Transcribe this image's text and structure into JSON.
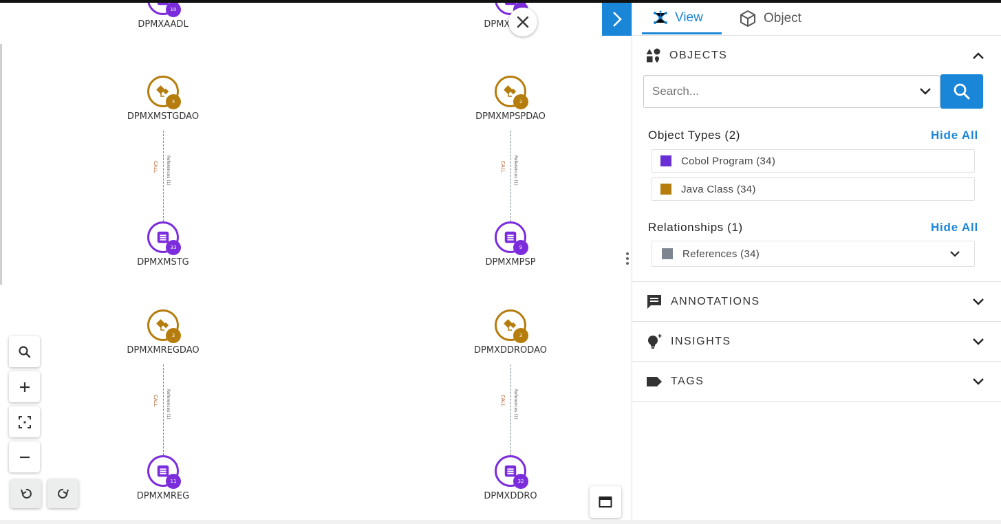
{
  "graph": {
    "nodes": [
      {
        "id": "DPMXAADL",
        "label": "DPMXAADL",
        "type": "cobol",
        "badge": "10"
      },
      {
        "id": "DPMXDCDO",
        "label": "DPMXDCDO",
        "type": "cobol",
        "badge": ""
      },
      {
        "id": "DPMXMSTGDAO",
        "label": "DPMXMSTGDAO",
        "type": "java",
        "badge": "3"
      },
      {
        "id": "DPMXMPSPDAO",
        "label": "DPMXMPSPDAO",
        "type": "java",
        "badge": "2"
      },
      {
        "id": "DPMXMSTG",
        "label": "DPMXMSTG",
        "type": "cobol",
        "badge": "33"
      },
      {
        "id": "DPMXMPSP",
        "label": "DPMXMPSP",
        "type": "cobol",
        "badge": "9"
      },
      {
        "id": "DPMXMREGDAO",
        "label": "DPMXMREGDAO",
        "type": "java",
        "badge": "3"
      },
      {
        "id": "DPMXDDRODAO",
        "label": "DPMXDDRODAO",
        "type": "java",
        "badge": "3"
      },
      {
        "id": "DPMXMREG",
        "label": "DPMXMREG",
        "type": "cobol",
        "badge": "11"
      },
      {
        "id": "DPMXDDRO",
        "label": "DPMXDDRO",
        "type": "cobol",
        "badge": "32"
      }
    ],
    "edges": [
      {
        "from": "DPMXMSTGDAO",
        "to": "DPMXMSTG",
        "call_label": "CALL",
        "ref_label": "References (1)"
      },
      {
        "from": "DPMXMPSPDAO",
        "to": "DPMXMPSP",
        "call_label": "CALL",
        "ref_label": "References (1)"
      },
      {
        "from": "DPMXMREGDAO",
        "to": "DPMXMREG",
        "call_label": "CALL",
        "ref_label": "References (1)"
      },
      {
        "from": "DPMXDDRODAO",
        "to": "DPMXDDRO",
        "call_label": "CALL",
        "ref_label": "References (1)"
      }
    ]
  },
  "canvas_tools": {
    "search": "search-icon",
    "zoom_in": "plus-icon",
    "fit": "fit-screen-icon",
    "zoom_out": "minus-icon",
    "undo": "undo-icon",
    "redo": "redo-icon",
    "fullscreen": "window-icon"
  },
  "panel": {
    "tabs": [
      {
        "label": "View",
        "icon": "graph-network-icon",
        "active": true
      },
      {
        "label": "Object",
        "icon": "cube-icon",
        "active": false
      }
    ],
    "objects": {
      "title": "OBJECTS",
      "search_placeholder": "Search...",
      "object_types_title": "Object Types (2)",
      "object_types_hide": "Hide All",
      "object_types": [
        {
          "label": "Cobol Program (34)",
          "color": "#6a2fd4"
        },
        {
          "label": "Java Class (34)",
          "color": "#b57d0d"
        }
      ],
      "relationships_title": "Relationships (1)",
      "relationships_hide": "Hide All",
      "relationships": [
        {
          "label": "References (34)",
          "color": "#7d8591"
        }
      ]
    },
    "sections": [
      {
        "title": "ANNOTATIONS",
        "icon": "comment-icon"
      },
      {
        "title": "INSIGHTS",
        "icon": "lightbulb-icon"
      },
      {
        "title": "TAGS",
        "icon": "tag-icon"
      }
    ]
  },
  "colors": {
    "accent": "#1a86d8",
    "cobol": "#7b2ddb",
    "java": "#b57d0d"
  }
}
